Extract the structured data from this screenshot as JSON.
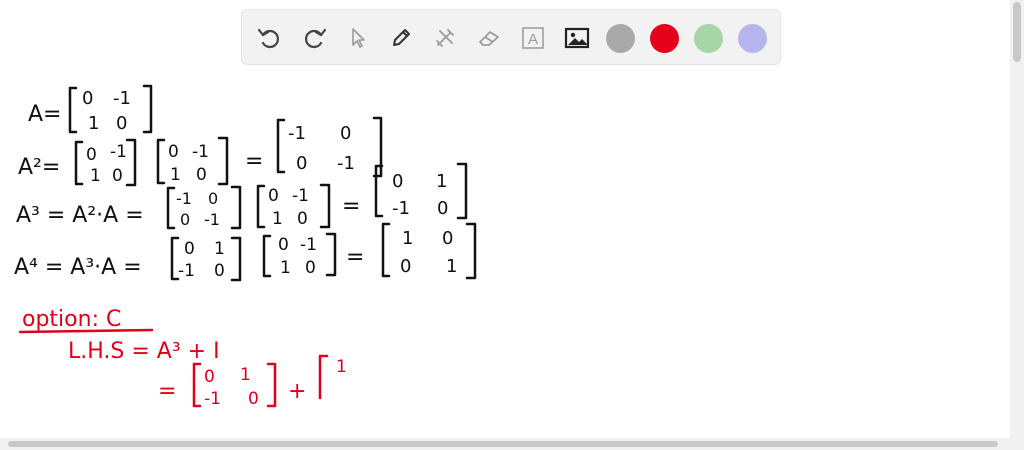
{
  "toolbar": {
    "tools": [
      {
        "name": "undo-icon"
      },
      {
        "name": "redo-icon"
      },
      {
        "name": "select-arrow-icon"
      },
      {
        "name": "pen-icon"
      },
      {
        "name": "tools-icon"
      },
      {
        "name": "eraser-icon"
      },
      {
        "name": "text-box-icon",
        "label": "A"
      },
      {
        "name": "image-icon"
      }
    ],
    "colors": [
      "#a9a9a9",
      "#e5001c",
      "#a8d5a5",
      "#b7b5f0"
    ]
  },
  "work": {
    "a_label": "A=",
    "a_matrix": [
      [
        "0",
        "-1"
      ],
      [
        "1",
        "0"
      ]
    ],
    "a2_label": "A²=",
    "a2_rhs": [
      [
        "-1",
        "0"
      ],
      [
        "0",
        "-1"
      ]
    ],
    "a3_label": "A³ = A²·A =",
    "a3_rhs": [
      [
        "0",
        "1"
      ],
      [
        "-1",
        "0"
      ]
    ],
    "a4_label": "A⁴ = A³·A =",
    "a4_rhs": [
      [
        "1",
        "0"
      ],
      [
        "0",
        "1"
      ]
    ],
    "equals": "="
  },
  "answer": {
    "heading": "option: C",
    "lhs_line": "L.H.S = A³ + I",
    "line2_eq": "=",
    "line2_matrix": [
      [
        "0",
        "1"
      ],
      [
        "-1",
        "0"
      ]
    ],
    "plus": "+",
    "partial": "1"
  },
  "colors": {
    "ink_black": "#111111",
    "ink_red": "#e0001a"
  }
}
